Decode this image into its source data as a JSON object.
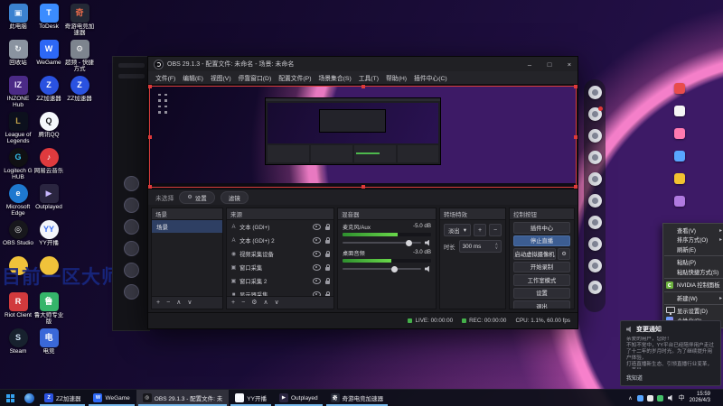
{
  "ui": {
    "submenu_arrow": "▸",
    "dropdown_arrow": "▾",
    "spin_up": "∧",
    "spin_down": "∨"
  },
  "overlay_text": "目前一区大师",
  "desktop": {
    "col1": [
      {
        "label": "此电脑",
        "glyph": "▣",
        "bg": "#3b82d0",
        "fg": "#eaf4ff"
      },
      {
        "label": "回收站",
        "glyph": "↻",
        "bg": "#8a93a0",
        "fg": "#f2f5f8"
      },
      {
        "label": "INZONE Hub",
        "glyph": "IZ",
        "bg": "#4b2a86",
        "fg": "#efe6ff"
      },
      {
        "label": "League of Legends",
        "glyph": "L",
        "bg": "#0c101d",
        "fg": "#c8a84b"
      },
      {
        "label": "Logitech G HUB",
        "glyph": "G",
        "bg": "#101013",
        "fg": "#35c3f2",
        "round": true
      },
      {
        "label": "Microsoft Edge",
        "glyph": "e",
        "bg": "#1e78cf",
        "fg": "#ffffff",
        "round": true
      },
      {
        "label": "OBS Studio",
        "glyph": "◎",
        "bg": "#17171c",
        "fg": "#f0f0f0",
        "round": true
      },
      {
        "label": "",
        "glyph": "",
        "bg": "#f0c23a",
        "round": true
      },
      {
        "label": "Riot Client",
        "glyph": "R",
        "bg": "#d13a3d",
        "fg": "#ffffff"
      },
      {
        "label": "Steam",
        "glyph": "S",
        "bg": "#17212e",
        "fg": "#cfe3f5",
        "round": true
      }
    ],
    "col2": [
      {
        "label": "ToDesk",
        "glyph": "T",
        "bg": "#3b8cff",
        "fg": "#ffffff"
      },
      {
        "label": "WeGame",
        "glyph": "W",
        "bg": "#2d68f5",
        "fg": "#ffffff"
      },
      {
        "label": "ZZ加速器",
        "glyph": "Z",
        "bg": "#2a52e0",
        "fg": "#ffffff",
        "round": true
      },
      {
        "label": "腾讯QQ",
        "glyph": "Q",
        "bg": "#f5f8fc",
        "fg": "#15161a",
        "round": true
      },
      {
        "label": "网易云音乐",
        "glyph": "♪",
        "bg": "#df3a3e",
        "fg": "#ffffff",
        "round": true
      },
      {
        "label": "Outplayed",
        "glyph": "▶",
        "bg": "#2a2540",
        "fg": "#c9b8ff"
      },
      {
        "label": "YY开播",
        "glyph": "YY",
        "bg": "#f3f5fa",
        "fg": "#3b6df0",
        "round": true
      },
      {
        "label": "",
        "glyph": "",
        "bg": "#f0c23a",
        "round": true
      },
      {
        "label": "鲁大师专业版",
        "glyph": "鲁",
        "bg": "#35b56a",
        "fg": "#ffffff"
      },
      {
        "label": "电竞",
        "glyph": "电",
        "bg": "#3a68d8",
        "fg": "#ffffff"
      }
    ],
    "col3": [
      {
        "label": "奇游电竞加速器",
        "glyph": "奇",
        "bg": "#242936",
        "fg": "#e86a4a"
      },
      {
        "label": "超频 - 快捷方式",
        "glyph": "⚙",
        "bg": "#7d848e",
        "fg": "#f2f2f2"
      },
      {
        "label": "ZZ加速器",
        "glyph": "Z",
        "bg": "#2a52e0",
        "fg": "#ffffff",
        "round": true
      }
    ]
  },
  "obs": {
    "title": "OBS 29.1.3 - 配置文件: 未命名 - 场景: 未命名",
    "min": "–",
    "max": "□",
    "close": "×",
    "menu": [
      "文件(F)",
      "编辑(E)",
      "视图(V)",
      "停靠窗口(D)",
      "配置文件(P)",
      "场景集合(S)",
      "工具(T)",
      "帮助(H)",
      "插件中心(C)"
    ],
    "selection": {
      "label": "未选择",
      "settings": "设置",
      "filters": "滤镜"
    },
    "toolbar_icons": {
      "add": "+",
      "remove": "−",
      "props": "⚙",
      "up": "∧",
      "down": "∨"
    },
    "scenes": {
      "title": "场景",
      "items": [
        {
          "name": "场景",
          "selected": true
        }
      ]
    },
    "sources": {
      "title": "来源",
      "items": [
        {
          "glyph": "A",
          "name": "文本 (GDI+)"
        },
        {
          "glyph": "A",
          "name": "文本 (GDI+) 2"
        },
        {
          "glyph": "◉",
          "name": "视频采集设备"
        },
        {
          "glyph": "▣",
          "name": "窗口采集"
        },
        {
          "glyph": "▣",
          "name": "窗口采集 2"
        },
        {
          "glyph": "■",
          "name": "显示器采集"
        }
      ]
    },
    "mixer": {
      "title": "混音器",
      "channels": [
        {
          "name": "麦克风/Aux",
          "db": "-5.0 dB",
          "meter": "62%",
          "slider": "84%"
        },
        {
          "name": "桌面音频",
          "db": "-3.0 dB",
          "meter": "55%",
          "slider": "66%"
        }
      ]
    },
    "transitions": {
      "title": "转场特效",
      "selected": "淡出",
      "add": "+",
      "remove": "−",
      "duration_label": "时长",
      "duration": "300 ms"
    },
    "controls": {
      "title": "控制按钮",
      "buttons": [
        {
          "label": "插件中心"
        },
        {
          "label": "停止直播",
          "active": true
        },
        {
          "label": "启动虚拟摄像机",
          "gear": true
        },
        {
          "label": "开始录制"
        },
        {
          "label": "工作室模式"
        },
        {
          "label": "设置"
        },
        {
          "label": "退出"
        }
      ]
    },
    "status": {
      "live": "LIVE: 00:00:00",
      "rec": "REC: 00:00:00",
      "cpu": "CPU: 1.1%, 60.00 fps"
    }
  },
  "context_menu": {
    "items": [
      {
        "label": "查看(V)",
        "submenu": true
      },
      {
        "label": "排序方式(O)",
        "submenu": true
      },
      {
        "label": "刷新(E)"
      },
      {
        "sep": true
      },
      {
        "label": "粘贴(P)"
      },
      {
        "label": "粘贴快捷方式(S)"
      },
      {
        "sep": true
      },
      {
        "label": "NVIDIA 控制面板",
        "nvidia": true
      },
      {
        "sep": true
      },
      {
        "label": "新建(W)",
        "submenu": true
      },
      {
        "sep": true
      },
      {
        "label": "显示设置(D)",
        "display_icon": true
      },
      {
        "label": "个性化(R)",
        "personalize_icon": true
      }
    ]
  },
  "notification": {
    "title": "变更通知",
    "lines": [
      "亲爱的用户，您好！",
      "不知不觉中，YY平台已经陪伴用户走过",
      "了十二年的岁月时光。为了继续提升用户体验，",
      "打造直播新生态、引领直播行业变革，一直是",
      "YY平台与YY人孜孜以求的梦想和信念。"
    ],
    "action": "我知道"
  },
  "taskbar": {
    "apps": [
      {
        "label": "ZZ加速器",
        "glyph": "Z",
        "bg": "#2a52e0",
        "fg": "#ffffff"
      },
      {
        "label": "WeGame",
        "glyph": "W",
        "bg": "#2d68f5",
        "fg": "#ffffff"
      },
      {
        "label": "OBS 29.1.3 - 配置文件: 未",
        "glyph": "◎",
        "bg": "#17171c",
        "fg": "#f0f0f0",
        "active": true
      },
      {
        "label": "YY开播",
        "glyph": "YY",
        "bg": "#f3f5fa",
        "fg": "#3b6df0"
      },
      {
        "label": "Outplayed",
        "glyph": "▶",
        "bg": "#2a2540",
        "fg": "#c9b8ff"
      },
      {
        "label": "奇游电竞加速器",
        "glyph": "奇",
        "bg": "#242936",
        "fg": "#e86a4a"
      }
    ],
    "tray": {
      "chevron": "∧",
      "input": "中",
      "time": "15:59",
      "date": "2026/4/3",
      "icon_colors": [
        "#58a6ff",
        "#e8e8e8",
        "#45c06a"
      ]
    }
  },
  "right_edge_icons": [
    "#e84c4c",
    "#f5f5f5",
    "#ff7ab0",
    "#58a6ff",
    "#f2c230",
    "#b07ae0"
  ]
}
